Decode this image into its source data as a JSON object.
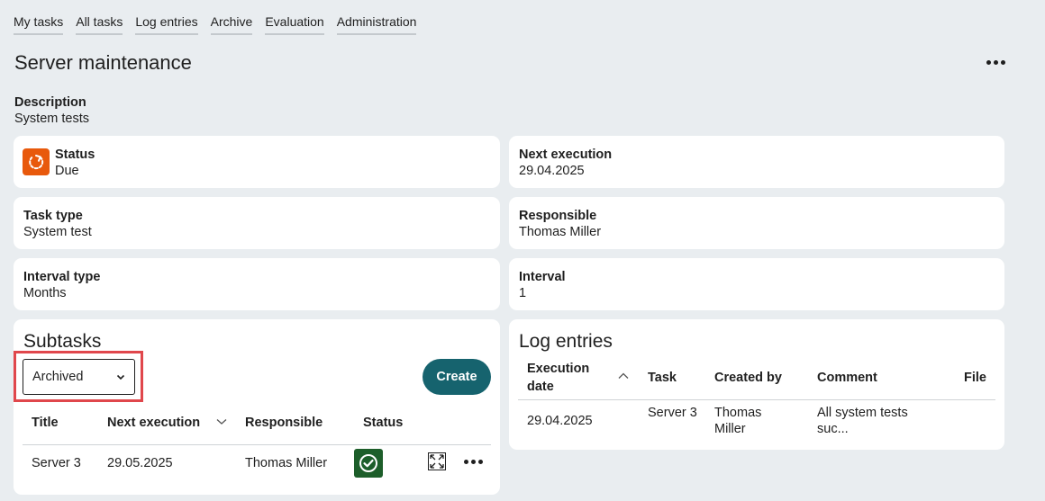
{
  "nav": [
    "My tasks",
    "All tasks",
    "Log entries",
    "Archive",
    "Evaluation",
    "Administration"
  ],
  "title": "Server maintenance",
  "description": {
    "label": "Description",
    "value": "System tests"
  },
  "fields": {
    "status": {
      "label": "Status",
      "value": "Due",
      "icon": "refresh-icon",
      "icon_color": "#e8590c"
    },
    "next_execution": {
      "label": "Next execution",
      "value": "29.04.2025"
    },
    "task_type": {
      "label": "Task type",
      "value": "System test"
    },
    "responsible": {
      "label": "Responsible",
      "value": "Thomas Miller"
    },
    "interval_type": {
      "label": "Interval type",
      "value": "Months"
    },
    "interval": {
      "label": "Interval",
      "value": "1"
    }
  },
  "subtasks": {
    "title": "Subtasks",
    "filter_selected": "Archived",
    "create_label": "Create",
    "columns": [
      "Title",
      "Next execution",
      "Responsible",
      "Status"
    ],
    "rows": [
      {
        "title": "Server 3",
        "next_execution": "29.05.2025",
        "responsible": "Thomas Miller",
        "status_icon": "check-circle-icon"
      }
    ]
  },
  "log_entries": {
    "title": "Log entries",
    "columns": [
      "Execution date",
      "Task",
      "Created by",
      "Comment",
      "File"
    ],
    "rows": [
      {
        "date": "29.04.2025",
        "task": "Server 3",
        "created_by": "Thomas Miller",
        "comment": "All system tests suc...",
        "file": ""
      }
    ]
  },
  "colors": {
    "accent": "#16636e",
    "status_due": "#e8590c",
    "status_done": "#1d5e2a",
    "highlight": "#e0474c"
  }
}
